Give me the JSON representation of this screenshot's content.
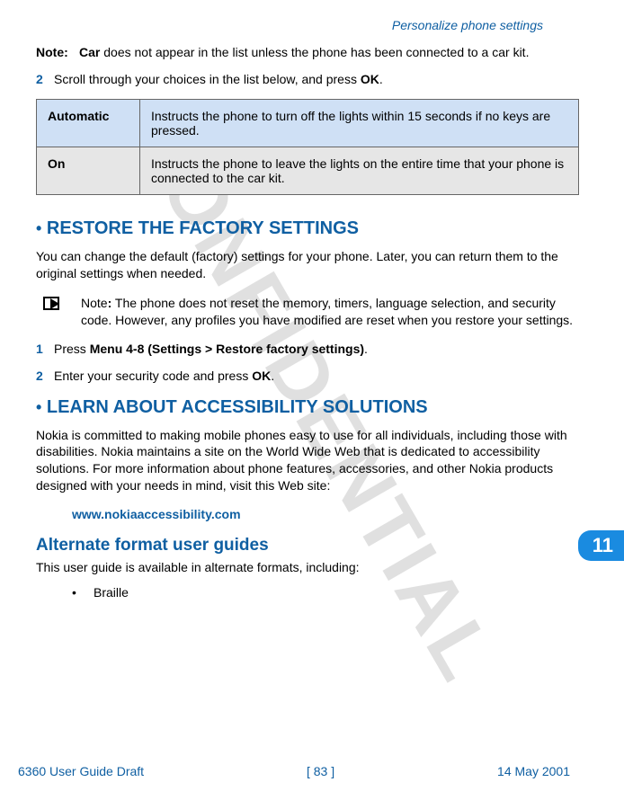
{
  "watermark": "CONFIDENTIAL",
  "header_link": "Personalize phone settings",
  "note1": {
    "label": "Note:",
    "prefix": "Car",
    "text": " does not appear in the list unless the phone has been connected to a car kit."
  },
  "step_pre": {
    "num": "2",
    "text_a": "Scroll through your choices in the list below, and press ",
    "text_b": "OK",
    "text_c": "."
  },
  "table": {
    "row1": {
      "label": "Automatic",
      "desc": "Instructs the phone to turn off the lights within 15 seconds if no keys are pressed."
    },
    "row2": {
      "label": "On",
      "desc": "Instructs the phone to leave the lights on the entire time that your phone is connected to the car kit."
    }
  },
  "section1": {
    "title": "RESTORE THE FACTORY SETTINGS",
    "body": "You can change the default (factory) settings for your phone. Later, you can return them to the original settings when needed.",
    "note_label": "Note",
    "note_text": " The phone does not reset the memory, timers, language selection, and security code. However, any profiles you have modified are reset when you restore your settings.",
    "step1": {
      "num": "1",
      "a": "Press ",
      "b": "Menu 4-8 (Settings > Restore factory settings)",
      "c": "."
    },
    "step2": {
      "num": "2",
      "a": "Enter your security code and press ",
      "b": "OK",
      "c": "."
    }
  },
  "section2": {
    "title": "LEARN ABOUT ACCESSIBILITY SOLUTIONS",
    "body": "Nokia is committed to making mobile phones easy to use for all individuals, including those with disabilities. Nokia maintains a site on the World Wide Web that is dedicated to accessibility solutions. For more information about phone features, accessories, and other Nokia products designed with your needs in mind, visit this Web site:",
    "url": "www.nokiaaccessibility.com",
    "sub": "Alternate format user guides",
    "sub_text": "This user guide is available in alternate formats, including:",
    "bullet1": "Braille"
  },
  "tab": "11",
  "footer": {
    "left": "6360 User Guide Draft",
    "center": "[ 83 ]",
    "right": "14 May 2001"
  },
  "bullet_char": "•"
}
